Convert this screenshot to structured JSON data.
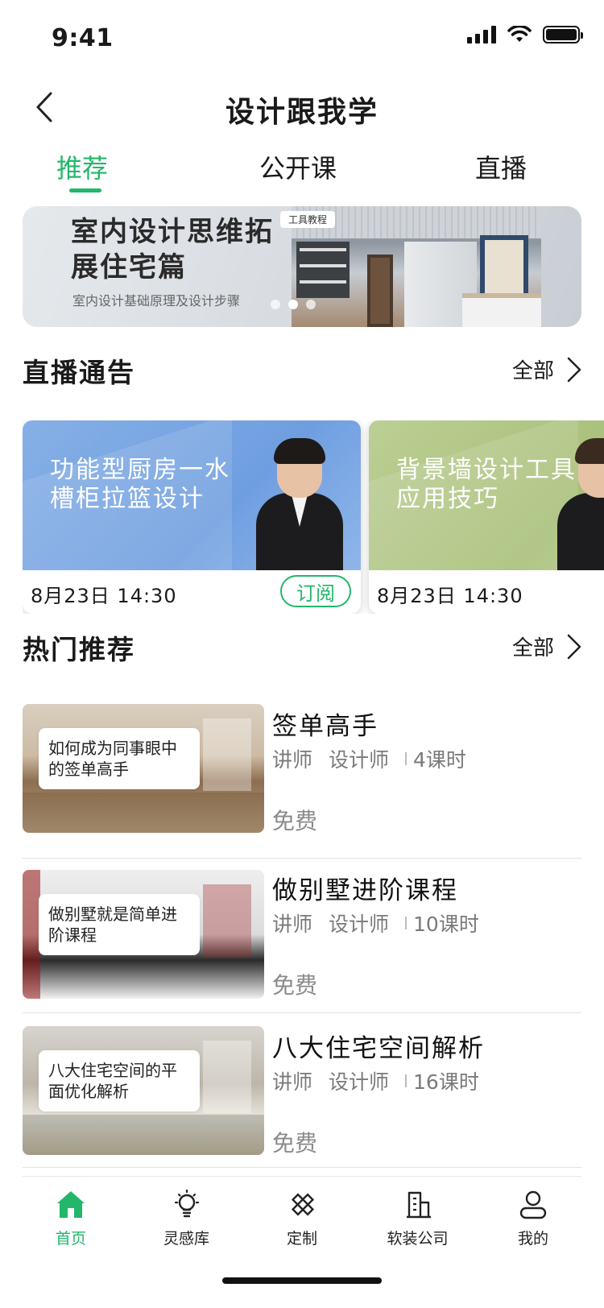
{
  "status_bar": {
    "time": "9:41"
  },
  "nav": {
    "title": "设计跟我学"
  },
  "tabs": [
    {
      "label": "推荐",
      "active": true
    },
    {
      "label": "公开课",
      "active": false
    },
    {
      "label": "直播",
      "active": false
    }
  ],
  "banner": {
    "title": "室内设计思维拓展住宅篇",
    "subtitle": "室内设计基础原理及设计步骤",
    "tag": "工具教程",
    "slide_count": 3,
    "active_slide": 2
  },
  "live_section": {
    "title": "直播通告",
    "more_label": "全部",
    "cards": [
      {
        "title": "功能型厨房一水槽柜拉篮设计",
        "time": "8月23日  14:30",
        "button": "订阅",
        "theme": "#76a5e3"
      },
      {
        "title": "背景墙设计工具应用技巧",
        "time": "8月23日  14:30",
        "button": "",
        "theme": "#aec27f"
      }
    ]
  },
  "hot_section": {
    "title": "热门推荐",
    "more_label": "全部",
    "courses": [
      {
        "thumb_label": "如何成为同事眼中的签单高手",
        "title": "签单高手",
        "lecturer_label": "讲师",
        "lecturer": "设计师",
        "lessons": "4课时",
        "price": "免费"
      },
      {
        "thumb_label": "做别墅就是简单进阶课程",
        "title": "做别墅进阶课程",
        "lecturer_label": "讲师",
        "lecturer": "设计师",
        "lessons": "10课时",
        "price": "免费"
      },
      {
        "thumb_label": "八大住宅空间的平面优化解析",
        "title": "八大住宅空间解析",
        "lecturer_label": "讲师",
        "lecturer": "设计师",
        "lessons": "16课时",
        "price": "免费"
      }
    ]
  },
  "tab_bar": {
    "accent": "#22b76a",
    "items": [
      {
        "label": "首页",
        "icon": "home-icon",
        "active": true
      },
      {
        "label": "灵感库",
        "icon": "lightbulb-icon",
        "active": false
      },
      {
        "label": "定制",
        "icon": "ruler-pencil-icon",
        "active": false
      },
      {
        "label": "软装公司",
        "icon": "building-icon",
        "active": false
      },
      {
        "label": "我的",
        "icon": "user-icon",
        "active": false
      }
    ]
  }
}
